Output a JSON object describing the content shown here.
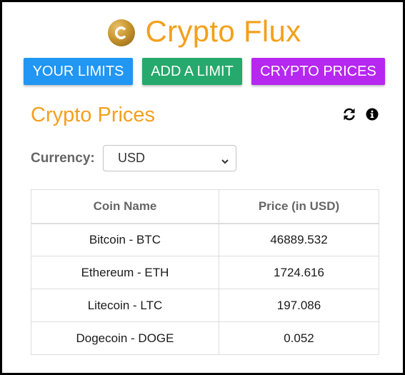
{
  "app": {
    "title": "Crypto Flux",
    "logo_icon": "bitcoin-coin-icon"
  },
  "nav": {
    "limits_label": "YOUR LIMITS",
    "add_label": "ADD A LIMIT",
    "prices_label": "CRYPTO PRICES"
  },
  "section": {
    "title": "Crypto Prices",
    "refresh_icon": "refresh-icon",
    "info_icon": "info-icon"
  },
  "currency": {
    "label": "Currency:",
    "selected": "USD"
  },
  "table": {
    "headers": [
      "Coin Name",
      "Price (in USD)"
    ],
    "rows": [
      {
        "coin": "Bitcoin - BTC",
        "price": "46889.532"
      },
      {
        "coin": "Ethereum - ETH",
        "price": "1724.616"
      },
      {
        "coin": "Litecoin - LTC",
        "price": "197.086"
      },
      {
        "coin": "Dogecoin - DOGE",
        "price": "0.052"
      }
    ]
  },
  "colors": {
    "accent": "#f4a01c",
    "limits_button": "#2196f3",
    "add_button": "#26a96c",
    "prices_button": "#b627f0"
  }
}
